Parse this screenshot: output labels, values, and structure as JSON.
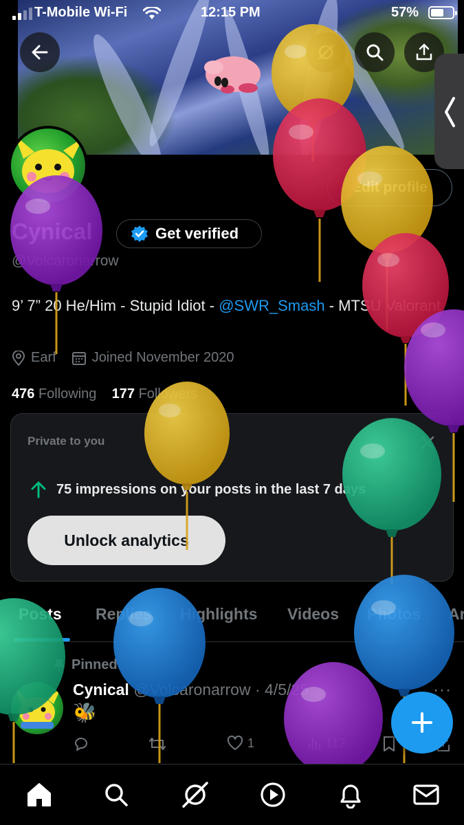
{
  "status_bar": {
    "carrier": "T-Mobile Wi-Fi",
    "time": "12:15 PM",
    "battery": "57%"
  },
  "profile": {
    "name": "Cynical",
    "get_verified_label": "Get verified",
    "handle": "@Volcaronarrow",
    "edit_profile_label": "Edit profile",
    "bio_text": "9’ 7” 20 He/Him - Stupid Idiot - ",
    "bio_mention": "@SWR_Smash",
    "bio_text_end": " - MTSU Valorant",
    "location": "Earf",
    "joined": "Joined November 2020",
    "following_count": "476",
    "following_label": "Following",
    "followers_count": "177",
    "followers_label": "Followers"
  },
  "analytics_card": {
    "label": "Private to you",
    "stat": "75 impressions on your posts in the last 7 days",
    "button_label": "Unlock analytics"
  },
  "tabs": [
    "Posts",
    "Replies",
    "Highlights",
    "Videos",
    "Photos",
    "Ar"
  ],
  "active_tab": "Posts",
  "post": {
    "pinned_label": "Pinned",
    "author_name": "Cynical",
    "author_handle": "@Volcaronarrow",
    "date": "· 4/5/25",
    "body": "🐝",
    "likes": "1",
    "views": "112",
    "more_label": "···"
  },
  "colors": {
    "accent": "#1d9bf0",
    "background": "#000000",
    "secondary_text": "#71767b"
  },
  "icons": {
    "nav": [
      "home-icon",
      "search-icon",
      "grok-icon",
      "video-icon",
      "notifications-icon",
      "messages-icon"
    ]
  }
}
